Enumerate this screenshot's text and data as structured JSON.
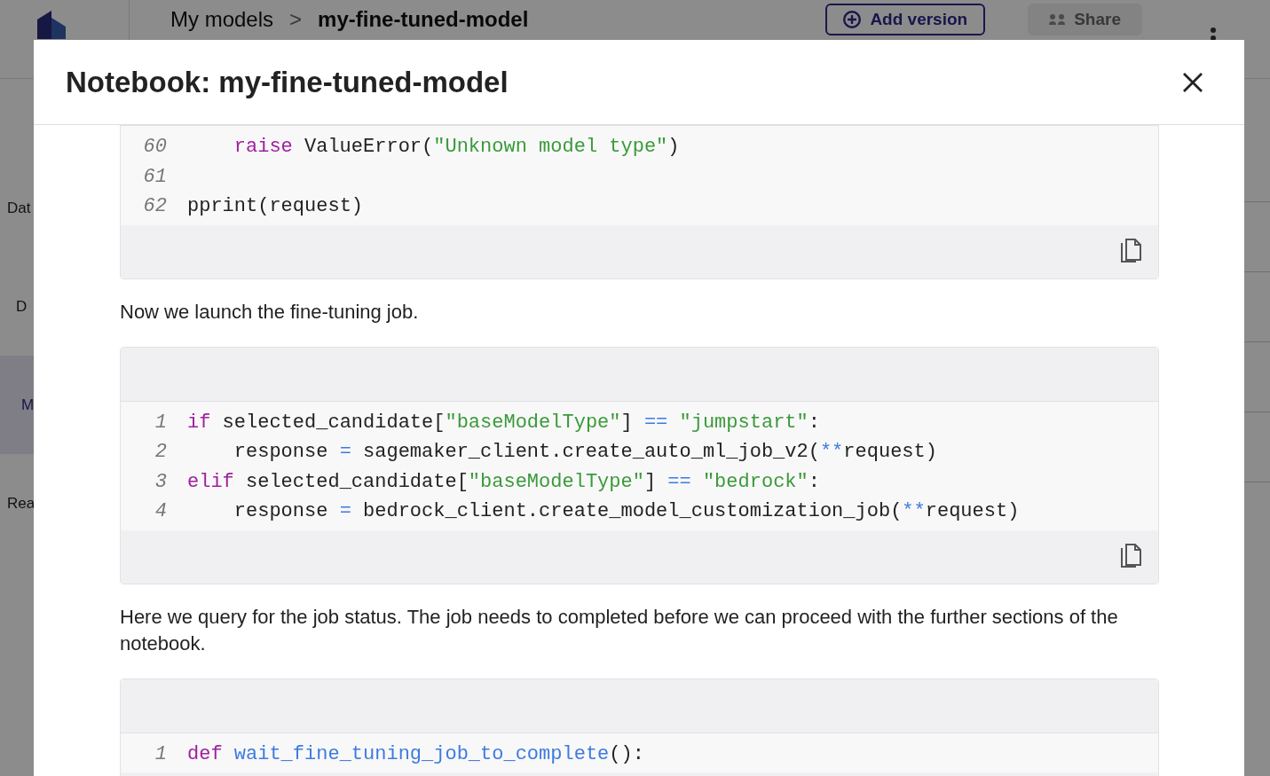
{
  "page": {
    "breadcrumb": [
      {
        "label": "My models"
      },
      {
        "label": "my-fine-tuned-model"
      }
    ],
    "separator": ">",
    "add_version_button": "Add version",
    "share_button": {
      "label": "Share",
      "disabled": true
    },
    "sidebar": {
      "items": [
        {
          "label": "Dat",
          "selected": false
        },
        {
          "label": "D",
          "selected": false
        },
        {
          "label": "M",
          "selected": true
        },
        {
          "label": "Rea",
          "selected": false
        }
      ]
    }
  },
  "modal": {
    "title": "Notebook: my-fine-tuned-model",
    "content": [
      {
        "kind": "code",
        "lines": [
          {
            "number": "60",
            "indented": true,
            "tokens": [
              {
                "kind": "keyword",
                "text": "raise"
              },
              {
                "kind": "plain",
                "text": " ValueError("
              },
              {
                "kind": "string",
                "text": "\"Unknown model type\""
              },
              {
                "kind": "plain",
                "text": ")"
              }
            ]
          },
          {
            "number": "61"
          },
          {
            "number": "62",
            "indented": false,
            "tokens": [
              {
                "kind": "plain",
                "text": "pprint(request)"
              }
            ]
          }
        ]
      },
      {
        "kind": "text",
        "text": "Now we launch the fine-tuning job."
      },
      {
        "kind": "code",
        "lines": [
          {
            "number": "1",
            "indented": false,
            "tokens": [
              {
                "kind": "keyword",
                "text": "if"
              },
              {
                "kind": "plain",
                "text": " selected_candidate["
              },
              {
                "kind": "string",
                "text": "\"baseModelType\""
              },
              {
                "kind": "plain",
                "text": "] "
              },
              {
                "kind": "operator",
                "text": "== "
              },
              {
                "kind": "string",
                "text": "\"jumpstart\""
              },
              {
                "kind": "plain",
                "text": ":"
              }
            ]
          },
          {
            "number": "2",
            "indented": true,
            "tokens": [
              {
                "kind": "plain",
                "text": "response "
              },
              {
                "kind": "operator",
                "text": "="
              },
              {
                "kind": "plain",
                "text": " sagemaker_client.create_auto_ml_job_v2("
              },
              {
                "kind": "operator",
                "text": "**"
              },
              {
                "kind": "plain",
                "text": "request)"
              }
            ]
          },
          {
            "number": "3",
            "indented": false,
            "tokens": [
              {
                "kind": "keyword",
                "text": "elif"
              },
              {
                "kind": "plain",
                "text": " selected_candidate["
              },
              {
                "kind": "string",
                "text": "\"baseModelType\""
              },
              {
                "kind": "plain",
                "text": "] "
              },
              {
                "kind": "operator",
                "text": "== "
              },
              {
                "kind": "string",
                "text": "\"bedrock\""
              },
              {
                "kind": "plain",
                "text": ":"
              }
            ]
          },
          {
            "number": "4",
            "indented": true,
            "tokens": [
              {
                "kind": "plain",
                "text": "response "
              },
              {
                "kind": "operator",
                "text": "="
              },
              {
                "kind": "plain",
                "text": " bedrock_client.create_model_customization_job("
              },
              {
                "kind": "operator",
                "text": "**"
              },
              {
                "kind": "plain",
                "text": "request)"
              }
            ]
          }
        ]
      },
      {
        "kind": "text",
        "text": "Here we query for the job status. The job needs to completed before we can proceed with the further sections of the notebook."
      },
      {
        "kind": "code",
        "lines": [
          {
            "number": "1",
            "indented": false,
            "tokens": [
              {
                "kind": "keyword",
                "text": "def "
              },
              {
                "kind": "function",
                "text": "wait_fine_tuning_job_to_complete"
              },
              {
                "kind": "plain",
                "text": "():"
              }
            ]
          }
        ]
      }
    ]
  }
}
